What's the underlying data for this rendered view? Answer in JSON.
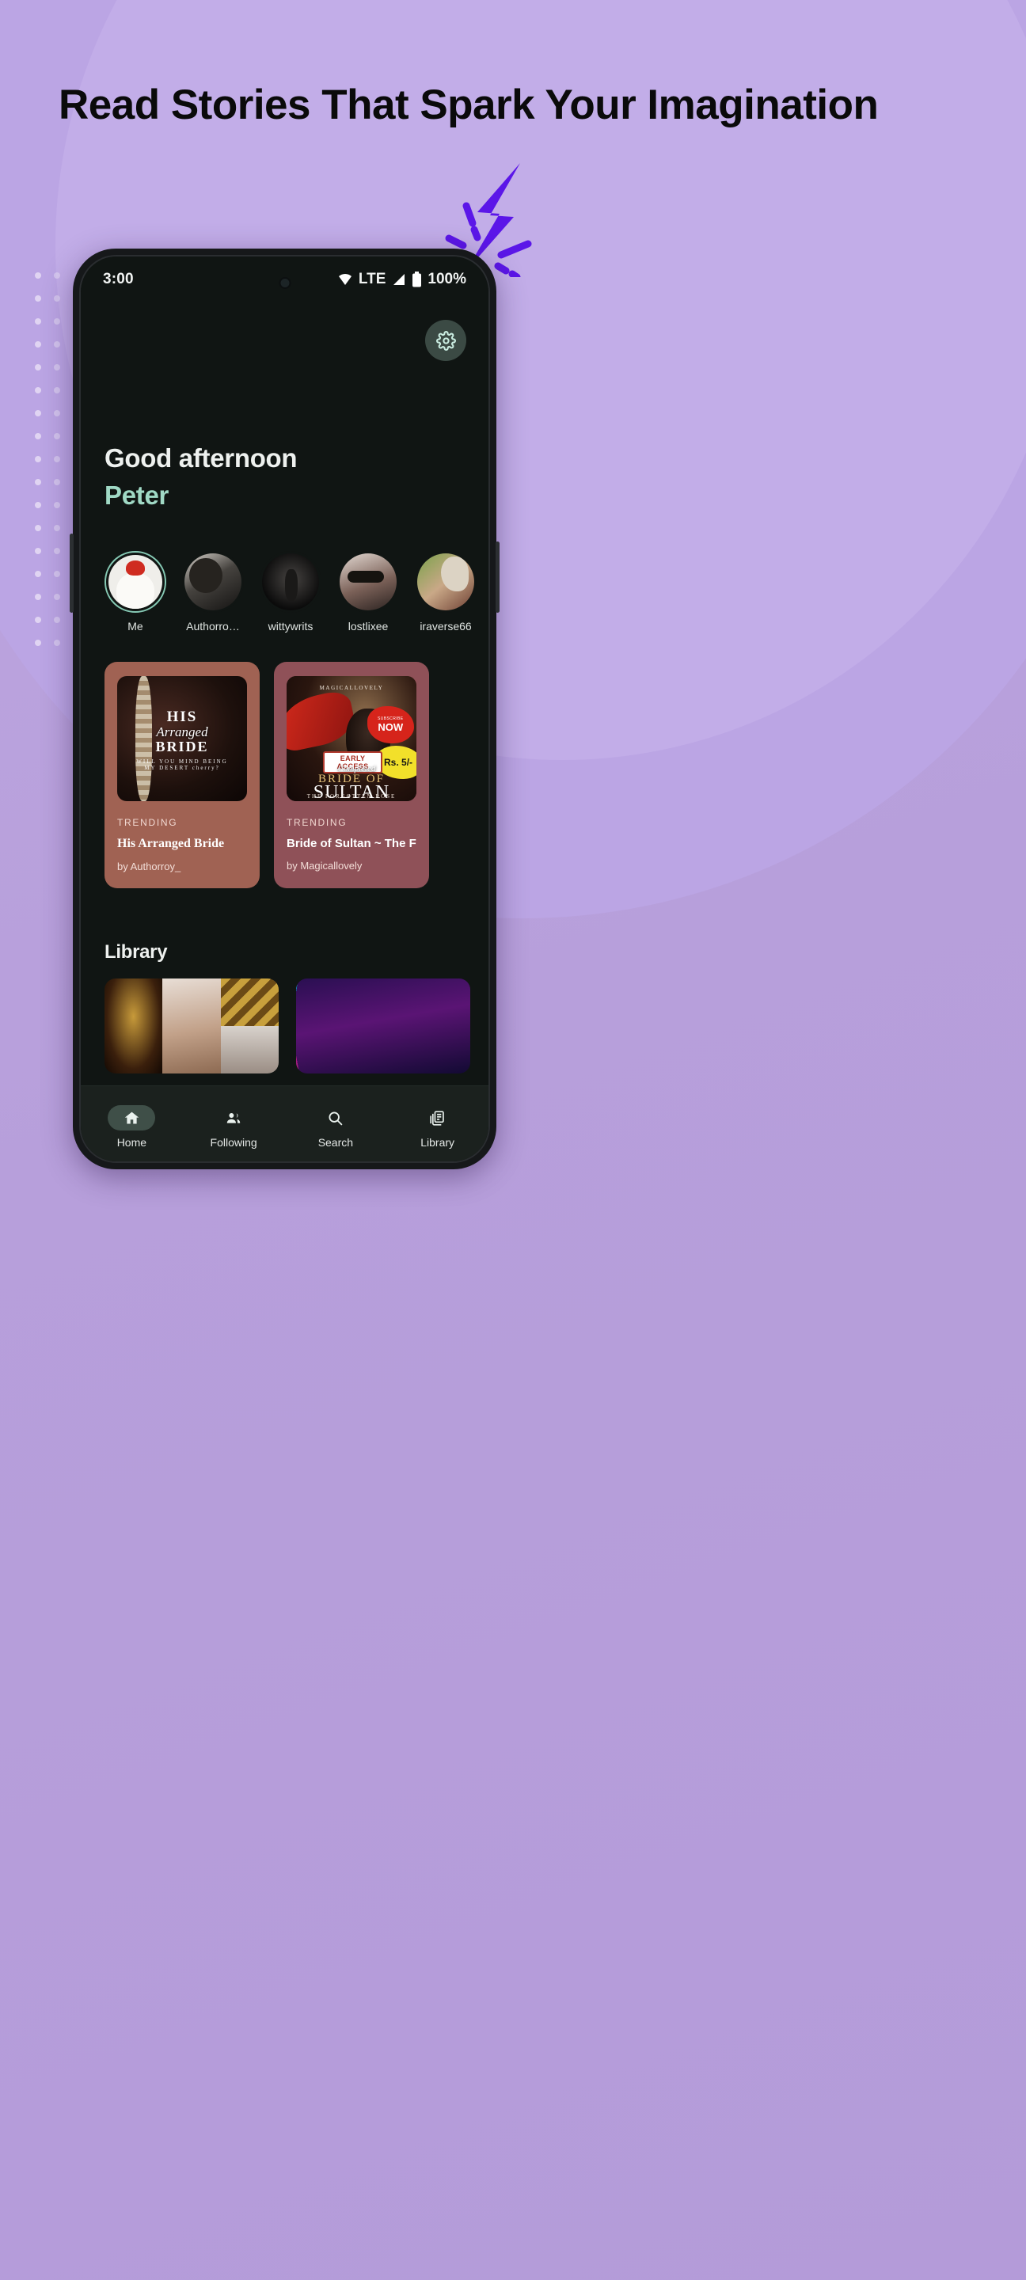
{
  "promo": {
    "headline": "Read Stories That Spark Your Imagination",
    "bolt_icon": "lightning-bolt-icon",
    "colors": {
      "background": "#b7a0dc",
      "bolt": "#5b16e8",
      "headline": "#0a0a0a"
    }
  },
  "phone": {
    "statusbar": {
      "time": "3:00",
      "wifi_icon": "wifi-icon",
      "network": "LTE",
      "signal_icon": "signal-bars-icon",
      "battery_icon": "battery-full-icon",
      "battery_text": "100%"
    },
    "settings_icon": "gear-icon",
    "greeting": {
      "line1": "Good afternoon",
      "line2": "Peter",
      "accent": "#a0d9c5"
    },
    "stories": [
      {
        "name": "Me",
        "avatar": "cat-with-red-bird-avatar",
        "active": true
      },
      {
        "name": "Authorro…",
        "avatar": "woman-portrait-avatar",
        "active": false
      },
      {
        "name": "wittywrits",
        "avatar": "dark-silhouette-avatar",
        "active": false
      },
      {
        "name": "lostlixee",
        "avatar": "woman-sunglasses-avatar",
        "active": false
      },
      {
        "name": "iraverse66",
        "avatar": "woman-plants-avatar",
        "active": false
      },
      {
        "name": "@",
        "avatar": "partial-avatar",
        "active": false
      }
    ],
    "trending": [
      {
        "label": "TRENDING",
        "title": "His Arranged Bride",
        "byline": "by Authorroy_",
        "card_color": "#a06253",
        "cover": {
          "line1": "HIS",
          "line2": "Arranged",
          "line3": "BRIDE",
          "tagline1": "WILL YOU MIND BEING",
          "tagline2": "MY DESERT cherry?"
        }
      },
      {
        "label": "TRENDING",
        "title": "Bride of Sultan ~ The F",
        "byline": "by Magicallovely",
        "card_color": "#8f5158",
        "cover": {
          "author": "MAGICALLOVELY",
          "badge_sub": "SUBSCRIBE",
          "badge_now": "NOW",
          "badge_early": "EARLY ACCESS",
          "badge_completed": "Completed",
          "price": "Rs. 5/-",
          "title_top": "BRIDE OF",
          "title_main": "SULTAN",
          "subtitle": "THE FORGOTTEN ROSE"
        }
      }
    ],
    "library": {
      "heading": "Library",
      "items": [
        {
          "thumb": "indian-wedding-collage-thumb"
        },
        {
          "thumb": "cyberpunk-city-thumb"
        }
      ]
    },
    "nav": [
      {
        "label": "Home",
        "icon": "home-icon",
        "active": true
      },
      {
        "label": "Following",
        "icon": "people-icon",
        "active": false
      },
      {
        "label": "Search",
        "icon": "search-icon",
        "active": false
      },
      {
        "label": "Library",
        "icon": "library-books-icon",
        "active": false
      }
    ]
  }
}
